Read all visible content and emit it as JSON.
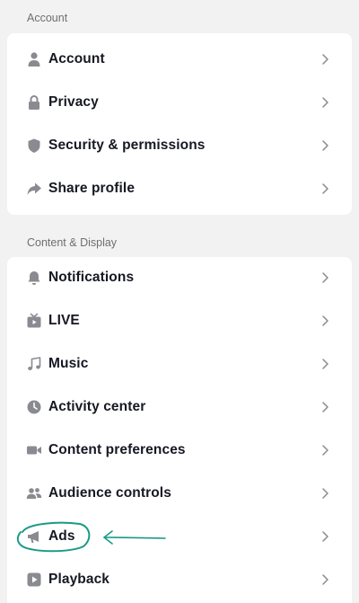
{
  "sections": [
    {
      "title": "Account",
      "items": [
        {
          "label": "Account",
          "icon": "person-icon"
        },
        {
          "label": "Privacy",
          "icon": "lock-icon"
        },
        {
          "label": "Security & permissions",
          "icon": "shield-icon"
        },
        {
          "label": "Share profile",
          "icon": "share-icon"
        }
      ]
    },
    {
      "title": "Content & Display",
      "items": [
        {
          "label": "Notifications",
          "icon": "bell-icon"
        },
        {
          "label": "LIVE",
          "icon": "tv-live-icon"
        },
        {
          "label": "Music",
          "icon": "music-note-icon"
        },
        {
          "label": "Activity center",
          "icon": "clock-icon"
        },
        {
          "label": "Content preferences",
          "icon": "video-camera-icon"
        },
        {
          "label": "Audience controls",
          "icon": "people-icon"
        },
        {
          "label": "Ads",
          "icon": "megaphone-icon"
        },
        {
          "label": "Playback",
          "icon": "play-icon"
        }
      ]
    }
  ],
  "colors": {
    "background": "#f2f2f2",
    "card": "#ffffff",
    "text": "#161823",
    "icon": "#8a8b91",
    "chevron": "#8a8b91",
    "annotation": "#1a9a86"
  }
}
